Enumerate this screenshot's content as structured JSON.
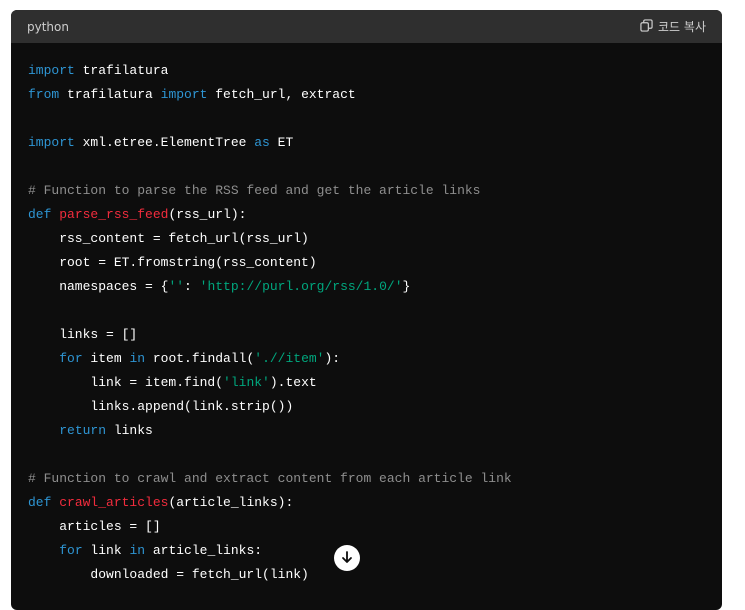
{
  "header": {
    "language": "python",
    "copy_label": "코드 복사"
  },
  "colors": {
    "keyword": "#2e95d3",
    "function": "#f22c3d",
    "string": "#00a67d",
    "comment": "#8e8e8e",
    "text": "#ffffff"
  },
  "code_lines": [
    [
      [
        "kw",
        "import"
      ],
      [
        "tx",
        " trafilatura"
      ]
    ],
    [
      [
        "kw",
        "from"
      ],
      [
        "tx",
        " trafilatura "
      ],
      [
        "kw",
        "import"
      ],
      [
        "tx",
        " fetch_url, extract"
      ]
    ],
    [],
    [
      [
        "kw",
        "import"
      ],
      [
        "tx",
        " xml.etree.ElementTree "
      ],
      [
        "kw",
        "as"
      ],
      [
        "tx",
        " ET"
      ]
    ],
    [],
    [
      [
        "cm",
        "# Function to parse the RSS feed and get the article links"
      ]
    ],
    [
      [
        "kw",
        "def"
      ],
      [
        "tx",
        " "
      ],
      [
        "fn",
        "parse_rss_feed"
      ],
      [
        "tx",
        "(rss_url):"
      ]
    ],
    [
      [
        "tx",
        "    rss_content = fetch_url(rss_url)"
      ]
    ],
    [
      [
        "tx",
        "    root = ET.fromstring(rss_content)"
      ]
    ],
    [
      [
        "tx",
        "    namespaces = {"
      ],
      [
        "str",
        "''"
      ],
      [
        "tx",
        ": "
      ],
      [
        "str",
        "'http://purl.org/rss/1.0/'"
      ],
      [
        "tx",
        "}"
      ]
    ],
    [],
    [
      [
        "tx",
        "    links = []"
      ]
    ],
    [
      [
        "tx",
        "    "
      ],
      [
        "kw",
        "for"
      ],
      [
        "tx",
        " item "
      ],
      [
        "kw",
        "in"
      ],
      [
        "tx",
        " root.findall("
      ],
      [
        "str",
        "'.//item'"
      ],
      [
        "tx",
        "):"
      ]
    ],
    [
      [
        "tx",
        "        link = item.find("
      ],
      [
        "str",
        "'link'"
      ],
      [
        "tx",
        ").text"
      ]
    ],
    [
      [
        "tx",
        "        links.append(link.strip())"
      ]
    ],
    [
      [
        "tx",
        "    "
      ],
      [
        "kw",
        "return"
      ],
      [
        "tx",
        " links"
      ]
    ],
    [],
    [
      [
        "cm",
        "# Function to crawl and extract content from each article link"
      ]
    ],
    [
      [
        "kw",
        "def"
      ],
      [
        "tx",
        " "
      ],
      [
        "fn",
        "crawl_articles"
      ],
      [
        "tx",
        "(article_links):"
      ]
    ],
    [
      [
        "tx",
        "    articles = []"
      ]
    ],
    [
      [
        "tx",
        "    "
      ],
      [
        "kw",
        "for"
      ],
      [
        "tx",
        " link "
      ],
      [
        "kw",
        "in"
      ],
      [
        "tx",
        " article_links:"
      ]
    ],
    [
      [
        "tx",
        "        downloaded = fetch_url(link)"
      ]
    ]
  ]
}
